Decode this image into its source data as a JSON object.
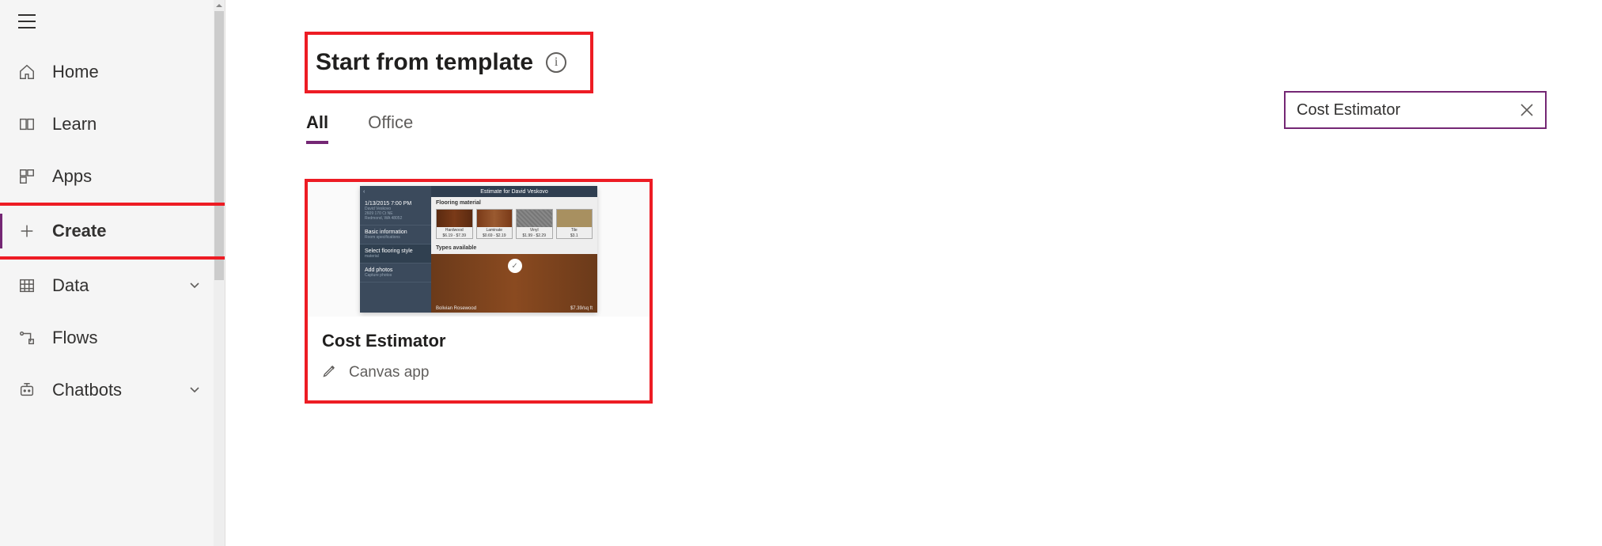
{
  "sidebar": {
    "items": [
      {
        "label": "Home"
      },
      {
        "label": "Learn"
      },
      {
        "label": "Apps"
      },
      {
        "label": "Create"
      },
      {
        "label": "Data"
      },
      {
        "label": "Flows"
      },
      {
        "label": "Chatbots"
      }
    ]
  },
  "page": {
    "heading": "Start from template",
    "info_glyph": "i"
  },
  "tabs": [
    {
      "label": "All",
      "active": true
    },
    {
      "label": "Office",
      "active": false
    }
  ],
  "search": {
    "value": "Cost Estimator"
  },
  "template_card": {
    "title": "Cost Estimator",
    "subtitle": "Canvas app",
    "thumb": {
      "header": "Estimate for David Veskovo",
      "meta_date": "1/13/2015 7:00 PM",
      "meta_name": "David Veskovo",
      "meta_addr1": "2609 170 Ct NE",
      "meta_addr2": "Redmond, WA 48052",
      "section_labels": {
        "basic": "Basic information",
        "basic_sub": "Room specifications",
        "style": "Select flooring style",
        "style_sub": "material",
        "photos": "Add photos",
        "photos_sub": "Capture photos",
        "flooring": "Flooring material",
        "types": "Types available"
      },
      "swatches": [
        {
          "name": "Hardwood",
          "price": "$6.19 - $7.39"
        },
        {
          "name": "Laminate",
          "price": "$0.69 - $2.19"
        },
        {
          "name": "Vinyl",
          "price": "$1.99 - $2.29"
        },
        {
          "name": "Tile",
          "price": "$3.1"
        }
      ],
      "selected": {
        "name": "Bolivian Rosewood",
        "price": "$7.39/sq ft"
      }
    }
  }
}
